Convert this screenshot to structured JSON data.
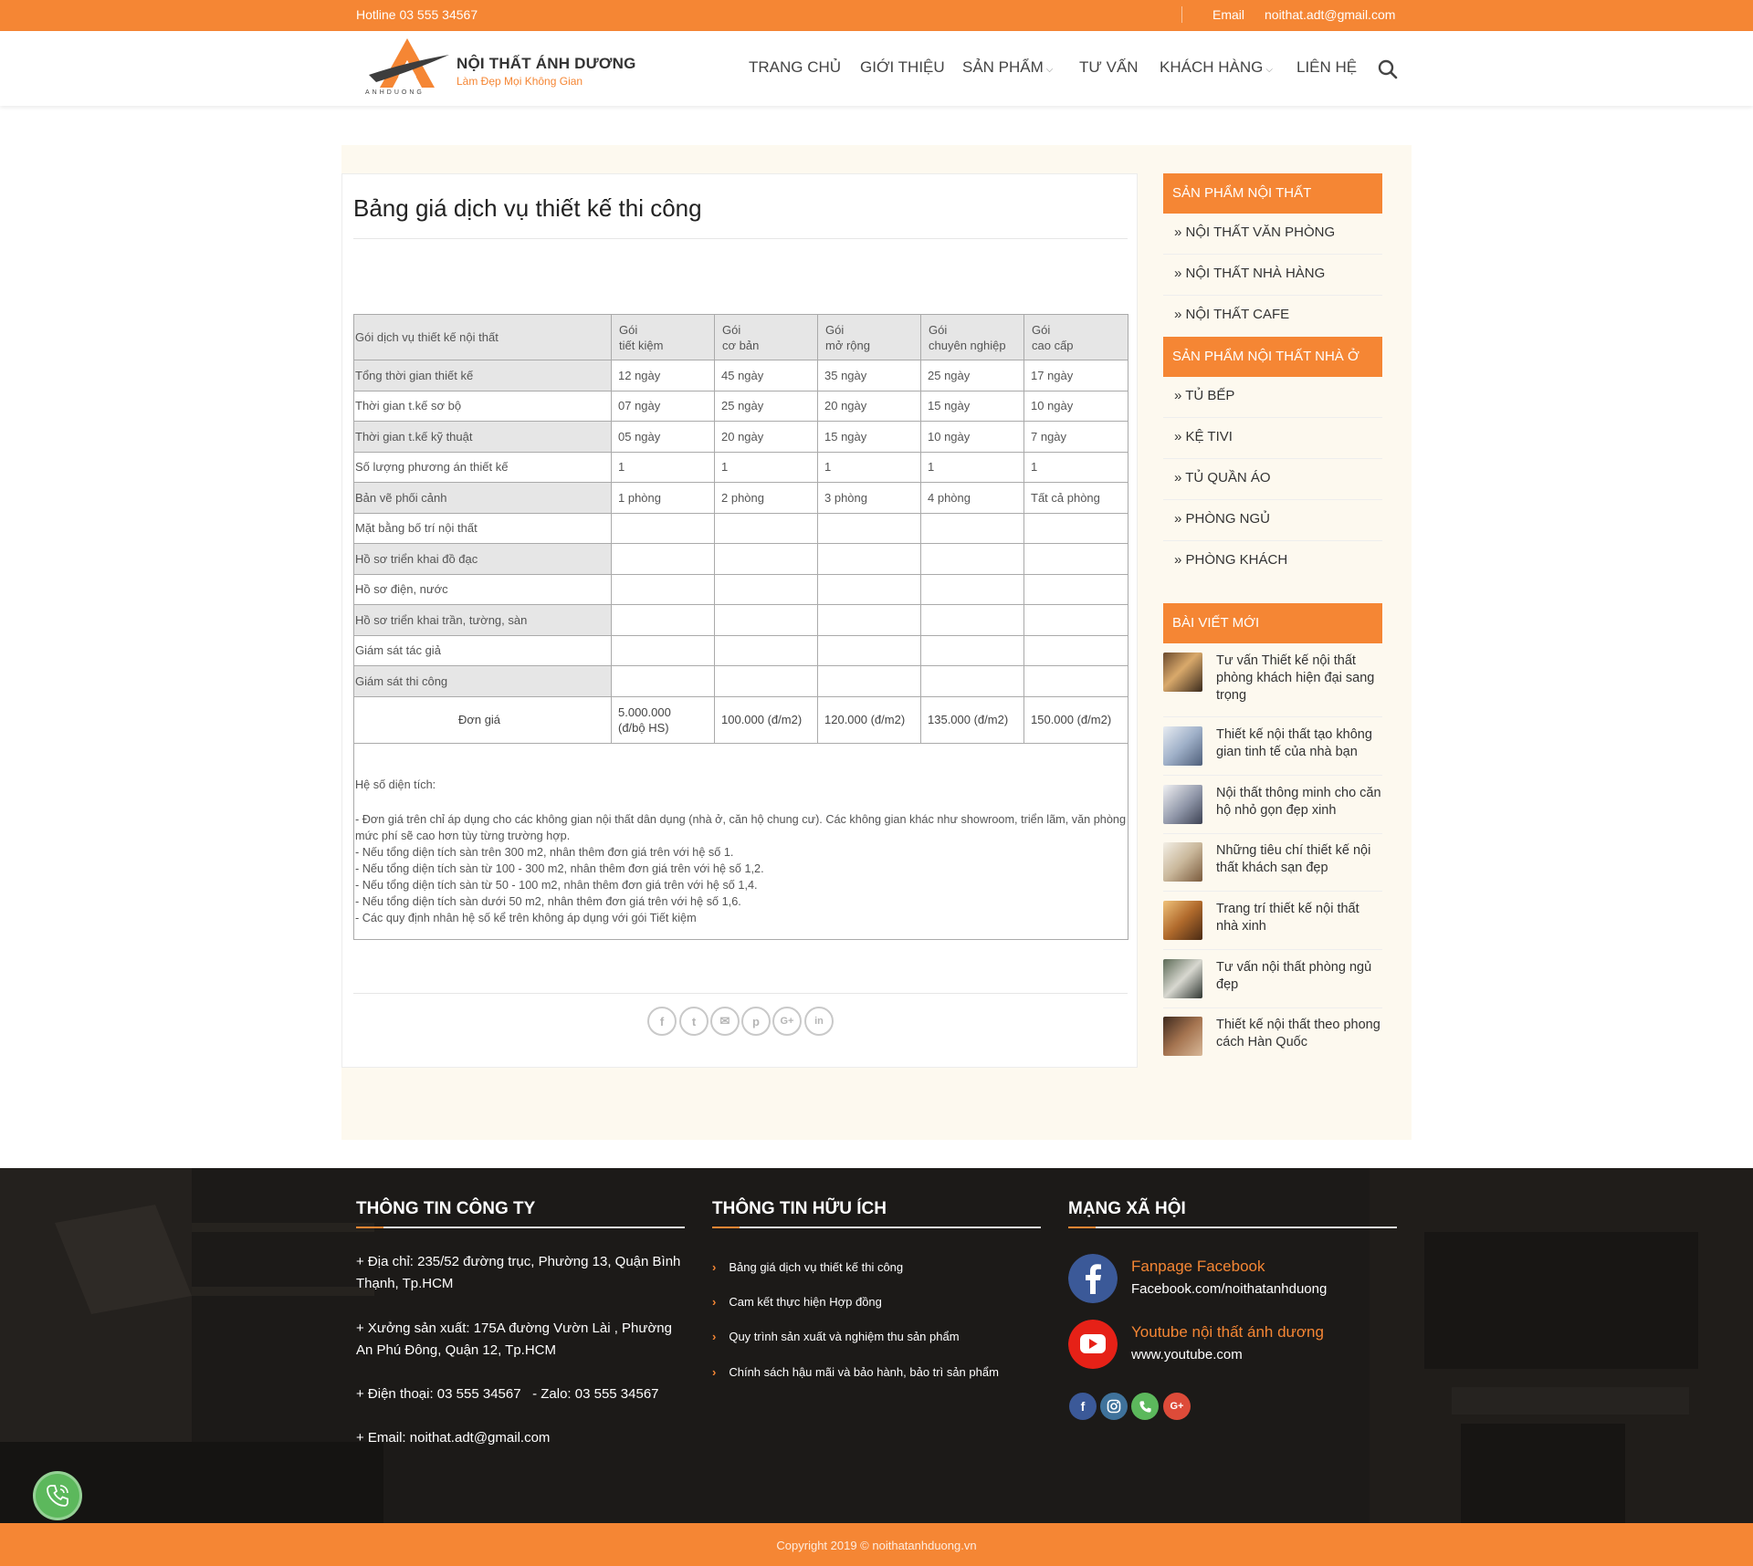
{
  "topbar": {
    "hotline": "Hotline 03 555 34567",
    "email_label": "Email",
    "email_value": "noithat.adt@gmail.com"
  },
  "header": {
    "brand": "NỘI THẤT ÁNH DƯƠNG",
    "slogan": "Làm Đẹp Mọi Không Gian",
    "logo_mark_text": "ANHDUONG",
    "nav": [
      {
        "label": "TRANG CHỦ"
      },
      {
        "label": "GIỚI THIỆU"
      },
      {
        "label": "SẢN PHẨM"
      },
      {
        "label": "TƯ VẤN"
      },
      {
        "label": "KHÁCH HÀNG"
      },
      {
        "label": "LIÊN HỆ"
      }
    ],
    "search_icon": "search-icon"
  },
  "article": {
    "title": "Bảng giá dịch vụ thiết kế thi công",
    "table": {
      "header_first": "Gói dịch vụ thiết kế nội thất",
      "packages": [
        {
          "l1": "Gói",
          "l2": "tiết kiệm"
        },
        {
          "l1": "Gói",
          "l2": "cơ bản"
        },
        {
          "l1": "Gói",
          "l2": "mở rộng"
        },
        {
          "l1": "Gói",
          "l2": "chuyên nghiệp"
        },
        {
          "l1": "Gói",
          "l2": "cao cấp"
        }
      ],
      "rows": [
        {
          "label": "Tổng thời gian thiết kế",
          "cells": [
            "12 ngày",
            "45 ngày",
            "35 ngày",
            "25 ngày",
            "17 ngày"
          ]
        },
        {
          "label": "Thời gian t.kế sơ bộ",
          "cells": [
            "07 ngày",
            "25 ngày",
            "20 ngày",
            "15 ngày",
            "10 ngày"
          ]
        },
        {
          "label": "Thời gian t.kế kỹ thuật",
          "cells": [
            "05 ngày",
            "20 ngày",
            "15 ngày",
            "10 ngày",
            "7 ngày"
          ]
        },
        {
          "label": "Số lượng phương án thiết kế",
          "cells": [
            "1",
            "1",
            "1",
            "1",
            "1"
          ]
        },
        {
          "label": "Bản vẽ phối cảnh",
          "cells": [
            "1 phòng",
            "2 phòng",
            "3 phòng",
            "4 phòng",
            "Tất cả phòng"
          ]
        },
        {
          "label": "Mặt bằng bố trí nội thất",
          "cells": [
            "",
            "",
            "",
            "",
            ""
          ]
        },
        {
          "label": "Hồ sơ triển khai đồ đạc",
          "cells": [
            "",
            "",
            "",
            "",
            ""
          ]
        },
        {
          "label": "Hồ sơ điện, nước",
          "cells": [
            "",
            "",
            "",
            "",
            ""
          ]
        },
        {
          "label": "Hồ sơ triển khai trần, tường, sàn",
          "cells": [
            "",
            "",
            "",
            "",
            ""
          ]
        },
        {
          "label": "Giám sát tác giả",
          "cells": [
            "",
            "",
            "",
            "",
            ""
          ]
        },
        {
          "label": "Giám sát thi công",
          "cells": [
            "",
            "",
            "",
            "",
            ""
          ]
        }
      ],
      "price_label": "Đơn giá",
      "prices": [
        {
          "l1": "5.000.000",
          "l2": "(đ/bộ HS)"
        },
        {
          "l1": "100.000 (đ/m2)",
          "l2": ""
        },
        {
          "l1": "120.000 (đ/m2)",
          "l2": ""
        },
        {
          "l1": "135.000 (đ/m2)",
          "l2": ""
        },
        {
          "l1": "150.000 (đ/m2)",
          "l2": ""
        }
      ],
      "notes_title": "Hệ số diện tích:",
      "notes": [
        "- Đơn giá trên chỉ áp dụng cho các không gian nội thất dân dụng (nhà ở, căn hộ chung cư). Các không gian khác như showroom, triển lãm, văn phòng mức phí sẽ cao hơn tùy từng trường hợp.",
        "- Nếu tổng diện tích sàn trên 300 m2, nhân thêm đơn giá trên với hệ số 1.",
        "- Nếu tổng diện tích sàn từ 100 - 300 m2, nhân thêm đơn giá trên với hệ số 1,2.",
        "- Nếu tổng diện tích sàn từ 50 - 100 m2, nhân thêm đơn giá trên với hệ số 1,4.",
        "- Nếu tổng diện tích sàn dưới 50 m2, nhân thêm đơn giá trên với hệ số 1,6.",
        "- Các quy định nhân hệ số kể trên không áp dụng với gói Tiết kiệm"
      ]
    },
    "share": [
      "f",
      "t",
      "✉",
      "p",
      "G+",
      "in"
    ]
  },
  "sidebar": {
    "section1_title": "SẢN PHẨM NỘI THẤT",
    "section1_items": [
      {
        "label": "» NỘI THẤT VĂN PHÒNG"
      },
      {
        "label": "» NỘI THẤT NHÀ HÀNG"
      },
      {
        "label": "» NỘI THẤT CAFE"
      }
    ],
    "section2_title": "SẢN PHẨM NỘI THẤT NHÀ Ở",
    "section2_items": [
      {
        "label": "» TỦ BẾP"
      },
      {
        "label": "» KỆ TIVI"
      },
      {
        "label": "» TỦ QUẦN ÁO"
      },
      {
        "label": "» PHÒNG NGỦ"
      },
      {
        "label": "» PHÒNG KHÁCH"
      }
    ],
    "section3_title": "BÀI VIẾT MỚI",
    "posts": [
      {
        "title": "Tư vấn Thiết kế nội thất phòng khách hiện đại sang trọng"
      },
      {
        "title": "Thiết kế nội thất tạo không gian tinh tế của nhà bạn"
      },
      {
        "title": "Nội thất thông minh cho căn hộ nhỏ gọn đẹp xinh"
      },
      {
        "title": "Những tiêu chí thiết kế nội thất khách sạn đẹp"
      },
      {
        "title": "Trang trí thiết kế nội thất nhà xinh"
      },
      {
        "title": "Tư vấn nội thất phòng ngủ đẹp"
      },
      {
        "title": "Thiết kế nội thất theo phong cách Hàn Quốc"
      }
    ]
  },
  "footer": {
    "col1_title": "THÔNG TIN CÔNG TY",
    "address": "+ Địa chỉ: 235/52 đường trục, Phường 13, Quận Bình Thạnh, Tp.HCM",
    "factory": "+ Xưởng sản xuất: 175A đường Vườn Lài , Phường An Phú Đông, Quận 12, Tp.HCM",
    "phone": "+ Điện thoại: 03 555 34567   - Zalo: 03 555 34567",
    "email": "+ Email: noithat.adt@gmail.com",
    "col2_title": "THÔNG TIN HỮU ÍCH",
    "links": [
      {
        "label": "Bảng giá dịch vụ thiết kế thi công"
      },
      {
        "label": "Cam kết thực hiện Hợp đồng"
      },
      {
        "label": "Quy trình sản xuất và nghiệm thu sản phẩm"
      },
      {
        "label": "Chính sách hậu mãi và bảo hành, bảo trì sản phẩm"
      }
    ],
    "col3_title": "MẠNG XÃ HỘI",
    "facebook_title": "Fanpage Facebook",
    "facebook_url": "Facebook.com/noithatanhduong",
    "youtube_title": "Youtube nội thất ánh dương",
    "youtube_url": "www.youtube.com",
    "copyright": "Copyright 2019 © noithatanhduong.vn"
  },
  "colors": {
    "accent": "#f58634",
    "footer_bg": "#1c1a18",
    "facebook": "#3b5998",
    "youtube": "#e62117",
    "instagram": "#3f729b",
    "phone": "#5cb85c",
    "google_plus": "#dd4b39"
  }
}
